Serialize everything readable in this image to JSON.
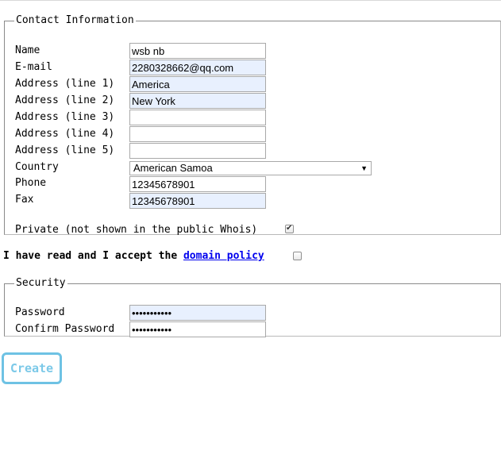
{
  "contact": {
    "legend": "Contact Information",
    "fields": [
      {
        "label": "Name",
        "value": ""
      },
      {
        "label": "E-mail",
        "value": "2280328662@qq.com"
      },
      {
        "label": "Address (line 1)",
        "value": "America"
      },
      {
        "label": "Address (line 2)",
        "value": "New York"
      },
      {
        "label": "Address (line 3)",
        "value": ""
      },
      {
        "label": "Address (line 4)",
        "value": ""
      },
      {
        "label": "Address (line 5)",
        "value": ""
      }
    ],
    "name_value": "wsb nb",
    "country": {
      "label": "Country",
      "selected": "American Samoa"
    },
    "phone": {
      "label": "Phone",
      "value": "12345678901"
    },
    "fax": {
      "label": "Fax",
      "value": "12345678901"
    },
    "private": {
      "label": "Private (not shown in the public Whois)",
      "checked": true
    }
  },
  "policy": {
    "text": "I have read and I accept the ",
    "link": "domain policy",
    "checked": false
  },
  "security": {
    "legend": "Security",
    "password": {
      "label": "Password",
      "value": "•••••••••••"
    },
    "confirm": {
      "label": "Confirm Password",
      "value": "•••••••••••"
    }
  },
  "actions": {
    "create_label": "Create"
  },
  "colors": {
    "autofill_bg": "#e8f0fe",
    "link": "#0000ee",
    "button_accent": "#6ec2e4"
  }
}
